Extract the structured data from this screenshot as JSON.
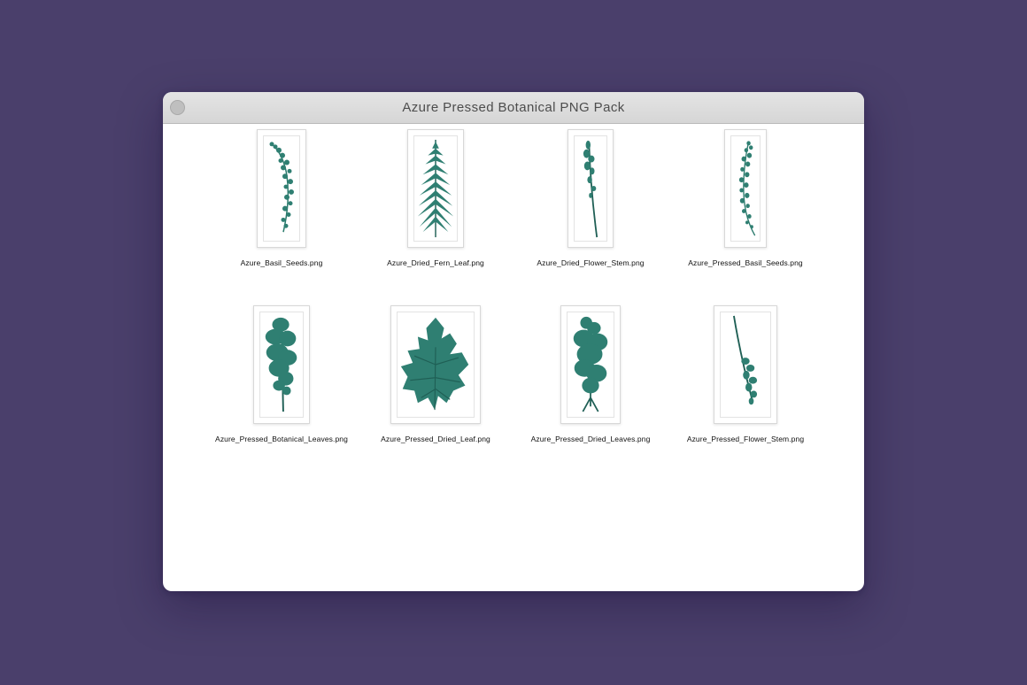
{
  "window": {
    "title": "Azure Pressed Botanical PNG Pack"
  },
  "colors": {
    "desktop": "#4a3f6b",
    "leaf": "#2f7f72",
    "leaf_dark": "#1f5f55"
  },
  "files": [
    {
      "name": "Azure_Basil_Seeds.png",
      "icon": "basil-seeds-thumbnail"
    },
    {
      "name": "Azure_Dried_Fern_Leaf.png",
      "icon": "fern-leaf-thumbnail"
    },
    {
      "name": "Azure_Dried_Flower_Stem.png",
      "icon": "flower-stem-thumbnail"
    },
    {
      "name": "Azure_Pressed_Basil_Seeds.png",
      "icon": "basil-seeds-thumbnail"
    },
    {
      "name": "Azure_Pressed_Botanical_Leaves.png",
      "icon": "leaves-thumbnail"
    },
    {
      "name": "Azure_Pressed_Dried_Leaf.png",
      "icon": "dried-leaf-thumbnail"
    },
    {
      "name": "Azure_Pressed_Dried_Leaves.png",
      "icon": "dried-leaves-thumbnail"
    },
    {
      "name": "Azure_Pressed_Flower_Stem.png",
      "icon": "flower-stem-thumbnail"
    }
  ]
}
